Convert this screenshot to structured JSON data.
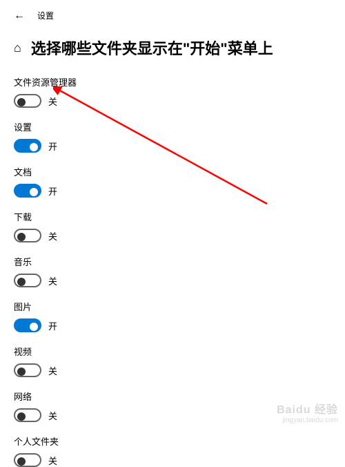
{
  "topbar": {
    "back_glyph": "←",
    "title": "设置"
  },
  "header": {
    "home_glyph": "⌂",
    "page_title": "选择哪些文件夹显示在\"开始\"菜单上"
  },
  "state_labels": {
    "on": "开",
    "off": "关"
  },
  "items": [
    {
      "id": "file-explorer",
      "label": "文件资源管理器",
      "on": false
    },
    {
      "id": "settings",
      "label": "设置",
      "on": true
    },
    {
      "id": "documents",
      "label": "文档",
      "on": true
    },
    {
      "id": "downloads",
      "label": "下载",
      "on": false
    },
    {
      "id": "music",
      "label": "音乐",
      "on": false
    },
    {
      "id": "pictures",
      "label": "图片",
      "on": true
    },
    {
      "id": "videos",
      "label": "视频",
      "on": false
    },
    {
      "id": "network",
      "label": "网络",
      "on": false
    },
    {
      "id": "personal-folder",
      "label": "个人文件夹",
      "on": false
    }
  ],
  "annotation": {
    "arrow_color": "#ff0000"
  },
  "watermark": {
    "line1": "Baidu 经验",
    "line2": "jingyan.baidu.com"
  }
}
